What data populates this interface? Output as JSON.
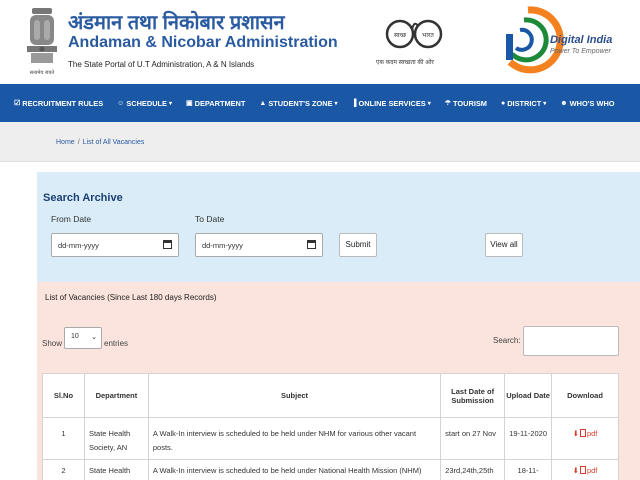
{
  "header": {
    "title_hindi": "अंडमान तथा निकोबार प्रशासन",
    "title_english": "Andaman & Nicobar Administration",
    "subtitle": "The State Portal of U.T Administration, A & N Islands",
    "emblem_caption": "सत्यमेव जयते",
    "swachh_left": "स्वच्छ",
    "swachh_right": "भारत",
    "swachh_tagline": "एक कदम स्वच्छता की ओर",
    "digital_india_title": "Digital India",
    "digital_india_tagline": "Power To Empower"
  },
  "nav": {
    "items": [
      {
        "label": "RECRUITMENT RULES",
        "icon": "check-square-icon",
        "dropdown": false
      },
      {
        "label": "SCHEDULE",
        "icon": "user-icon",
        "dropdown": true
      },
      {
        "label": "DEPARTMENT",
        "icon": "building-icon",
        "dropdown": false
      },
      {
        "label": "STUDENT'S ZONE",
        "icon": "graduation-cap-icon",
        "dropdown": true
      },
      {
        "label": "ONLINE SERVICES",
        "icon": "bar-chart-icon",
        "dropdown": true
      },
      {
        "label": "TOURISM",
        "icon": "umbrella-icon",
        "dropdown": false
      },
      {
        "label": "DISTRICT",
        "icon": "map-marker-icon",
        "dropdown": true
      },
      {
        "label": "WHO'S WHO",
        "icon": "users-icon",
        "dropdown": false
      }
    ]
  },
  "breadcrumb": {
    "home": "Home",
    "current": "List of All Vacancies",
    "separator": "/"
  },
  "search_archive": {
    "title": "Search Archive",
    "from_label": "From Date",
    "to_label": "To Date",
    "date_placeholder": "dd-mm-yyyy",
    "submit_label": "Submit",
    "view_all_label": "View all"
  },
  "vacancies": {
    "title": "List of Vacancies (Since Last 180 days Records)",
    "show_label": "Show",
    "entries_value": "10",
    "entries_label": "entries",
    "search_label": "Search:",
    "columns": [
      "Sl.No",
      "Department",
      "Subject",
      "Last Date of Submission",
      "Upload Date",
      "Download"
    ],
    "rows": [
      {
        "sl": "1",
        "department": "State Health Society, AN",
        "subject": "A Walk-In interview is scheduled to be held under NHM for various other vacant posts.",
        "last_date": "start on 27 Nov",
        "upload_date": "19-11-2020",
        "download": "pdf"
      },
      {
        "sl": "2",
        "department": "State Health",
        "subject": "A Walk-In interview is scheduled to be held under National Health Mission (NHM)",
        "last_date": "23rd,24th,25th",
        "upload_date": "18-11-",
        "download": "pdf"
      }
    ]
  },
  "colors": {
    "nav_bg": "#1a58a6",
    "title_blue": "#2a5aa0",
    "search_panel_bg": "#d9ecf7",
    "vacancy_panel_bg": "#fbe4dd",
    "download_red": "#d63c2c"
  }
}
